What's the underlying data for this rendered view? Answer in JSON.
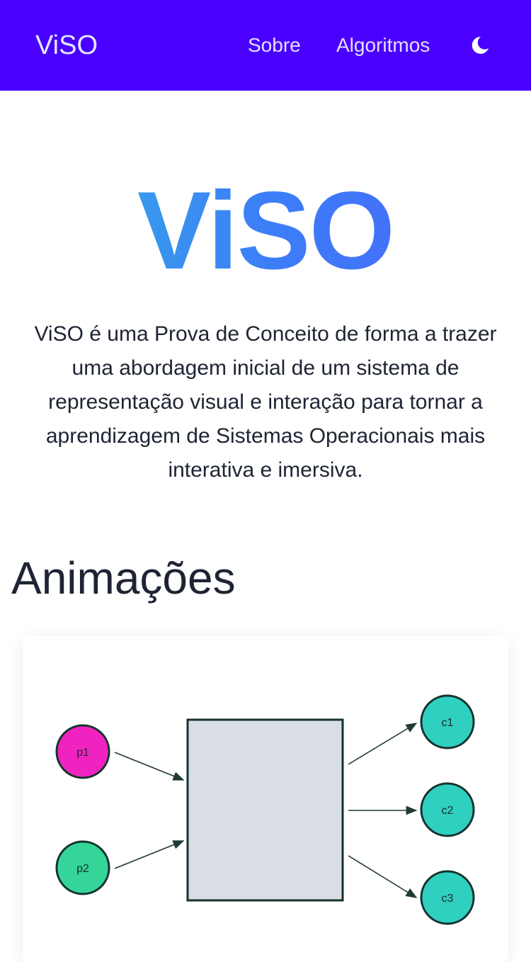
{
  "navbar": {
    "brand": "ViSO",
    "links": [
      "Sobre",
      "Algoritmos"
    ],
    "theme_icon": "moon-icon"
  },
  "hero": {
    "logo_text": "ViSO",
    "description": "ViSO é uma Prova de Conceito de forma a trazer uma abordagem inicial de um sistema de representação visual e interação para tornar a aprendizagem de Sistemas Operacionais mais interativa e imersiva."
  },
  "animations": {
    "title": "Animações",
    "diagram": {
      "producers": [
        {
          "label": "p1",
          "color": "#f123c0"
        },
        {
          "label": "p2",
          "color": "#35d59a"
        }
      ],
      "consumers": [
        {
          "label": "c1",
          "color": "#2fd0c0"
        },
        {
          "label": "c2",
          "color": "#2fd0c0"
        },
        {
          "label": "c3",
          "color": "#2fd0c0"
        }
      ],
      "buffer_color": "#d9dee6"
    }
  }
}
